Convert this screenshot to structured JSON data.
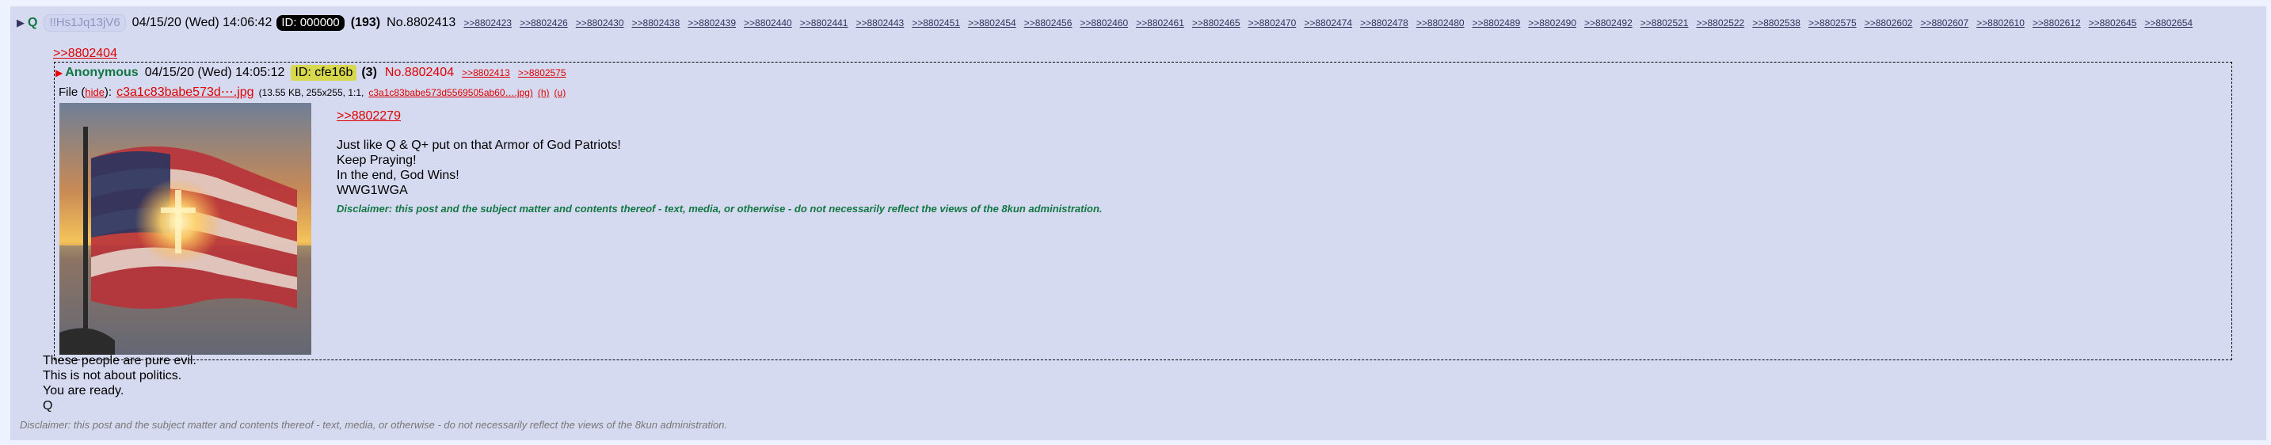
{
  "header": {
    "toggle": "▶",
    "name": "Q",
    "tripcode": "!!Hs1Jq13jV6",
    "date": "04/15/20 (Wed) 14:06:42",
    "id": "ID: 000000",
    "count": "(193)",
    "post_no": "No.8802413",
    "backlinks": [
      ">>8802423",
      ">>8802426",
      ">>8802430",
      ">>8802438",
      ">>8802439",
      ">>8802440",
      ">>8802441",
      ">>8802443",
      ">>8802451",
      ">>8802454",
      ">>8802456",
      ">>8802460",
      ">>8802461",
      ">>8802465",
      ">>8802470",
      ">>8802474",
      ">>8802478",
      ">>8802480",
      ">>8802489",
      ">>8802490",
      ">>8802492",
      ">>8802521",
      ">>8802522",
      ">>8802538",
      ">>8802575",
      ">>8802602",
      ">>8802607",
      ">>8802610",
      ">>8802612",
      ">>8802645",
      ">>8802654"
    ]
  },
  "quote_link": ">>8802404",
  "quoted_post": {
    "toggle": "▶",
    "name": "Anonymous",
    "date": "04/15/20 (Wed) 14:05:12",
    "id": "ID: cfe16b",
    "count": "(3)",
    "post_no": "No.8802404",
    "backlinks": [
      ">>8802413",
      ">>8802575"
    ],
    "file_label": "File (",
    "hide": "hide",
    "file_label_end": "):",
    "file_name": "c3a1c83babe573d⋯.jpg",
    "file_meta": "(13.55 KB, 255x255, 1:1,",
    "file_full": "c3a1c83babe573d5569505ab60….jpg)",
    "file_h": "(h)",
    "file_u": "(u)",
    "reply_to": ">>8802279",
    "lines": [
      "Just like Q & Q+ put on that Armor of God Patriots!",
      "Keep Praying!",
      "In the end, God Wins!",
      "WWG1WGA"
    ],
    "disclaimer": "Disclaimer: this post and the subject matter and contents thereof - text, media, or otherwise - do not necessarily reflect the views of the 8kun administration."
  },
  "body_lines": [
    "These people are pure evil.",
    "This is not about politics.",
    "You are ready.",
    "Q"
  ],
  "footer_disclaimer": "Disclaimer: this post and the subject matter and contents thereof - text, media, or otherwise - do not necessarily reflect the views of the 8kun administration."
}
